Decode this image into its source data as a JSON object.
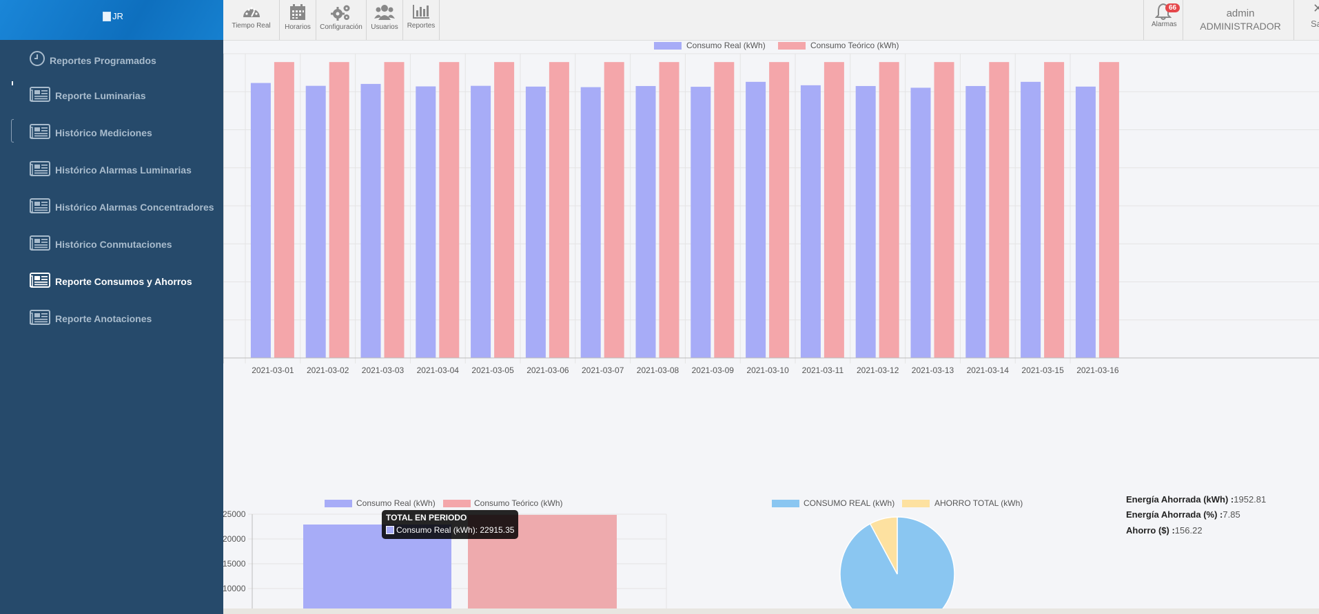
{
  "sidebar": {
    "logo_alt": "JR",
    "items": [
      {
        "label": "Reportes Programados",
        "icon": "clock-icon",
        "active": false
      },
      {
        "label": "Reporte Luminarias",
        "icon": "newspaper-icon",
        "active": false
      },
      {
        "label": "Histórico Mediciones",
        "icon": "newspaper-icon",
        "active": false
      },
      {
        "label": "Histórico Alarmas Luminarias",
        "icon": "newspaper-icon",
        "active": false
      },
      {
        "label": "Histórico Alarmas Concentradores",
        "icon": "newspaper-icon",
        "active": false
      },
      {
        "label": "Histórico Conmutaciones",
        "icon": "newspaper-icon",
        "active": false
      },
      {
        "label": "Reporte Consumos y Ahorros",
        "icon": "newspaper-icon",
        "active": true
      },
      {
        "label": "Reporte Anotaciones",
        "icon": "newspaper-icon",
        "active": false
      }
    ]
  },
  "topbar": {
    "buttons": [
      {
        "label": "Tiempo Real",
        "icon": "speedometer-icon"
      },
      {
        "label": "Horarios",
        "icon": "calendar-icon"
      },
      {
        "label": "Configuración",
        "icon": "gears-icon"
      },
      {
        "label": "Usuarios",
        "icon": "users-icon"
      },
      {
        "label": "Reportes",
        "icon": "bar-chart-icon"
      }
    ],
    "alarms": {
      "label": "Alarmas",
      "count": "66"
    },
    "user": {
      "name": "admin",
      "role": "ADMINISTRADOR"
    },
    "close_symbol": "✕",
    "partial_label": "Sa"
  },
  "colors": {
    "real": "#a7acf7",
    "teorico": "#f4a6aa",
    "pie_real": "#8ac6f1",
    "pie_ahorro": "#fde1a0"
  },
  "chart_data": [
    {
      "type": "bar",
      "categories": [
        "2021-03-01",
        "2021-03-02",
        "2021-03-03",
        "2021-03-04",
        "2021-03-05",
        "2021-03-06",
        "2021-03-07",
        "2021-03-08",
        "2021-03-09",
        "2021-03-10",
        "2021-03-11",
        "2021-03-12",
        "2021-03-13",
        "2021-03-14",
        "2021-03-15",
        "2021-03-16"
      ],
      "series": [
        {
          "name": "Consumo Real (kWh)",
          "values": [
            1446,
            1431,
            1441,
            1428,
            1431,
            1427,
            1424,
            1430,
            1426,
            1452,
            1434,
            1430,
            1421,
            1430,
            1452,
            1427
          ]
        },
        {
          "name": "Consumo Teórico (kWh)",
          "values": [
            1556,
            1556,
            1556,
            1556,
            1556,
            1556,
            1556,
            1556,
            1556,
            1556,
            1556,
            1556,
            1556,
            1556,
            1556,
            1556
          ]
        }
      ],
      "ylim": [
        0,
        1600
      ],
      "yticks": [
        0,
        200,
        400,
        600,
        800,
        1000,
        1200,
        1400,
        1600
      ],
      "grid": true,
      "legend": "top-center"
    },
    {
      "type": "bar",
      "categories": [
        "TOTAL EN PERIODO"
      ],
      "series": [
        {
          "name": "Consumo Real (kWh)",
          "values": [
            22915.35
          ]
        },
        {
          "name": "Consumo Teórico (kWh)",
          "values": [
            24868.16
          ]
        }
      ],
      "yticks_visible": [
        10000,
        15000,
        20000,
        25000
      ],
      "legend": "top-center",
      "tooltip": {
        "title": "TOTAL EN PERIODO",
        "label": "Consumo Real (kWh): 22915.35"
      }
    },
    {
      "type": "pie",
      "labels": [
        "CONSUMO REAL (kWh)",
        "AHORRO TOTAL (kWh)"
      ],
      "values": [
        22915.35,
        1952.81
      ],
      "legend": "top-center"
    }
  ],
  "kpis": [
    {
      "label": "Energía Ahorrada (kWh) :",
      "value": "1952.81"
    },
    {
      "label": "Energía Ahorrada (%) :",
      "value": "7.85"
    },
    {
      "label": "Ahorro ($) :",
      "value": "156.22"
    }
  ]
}
